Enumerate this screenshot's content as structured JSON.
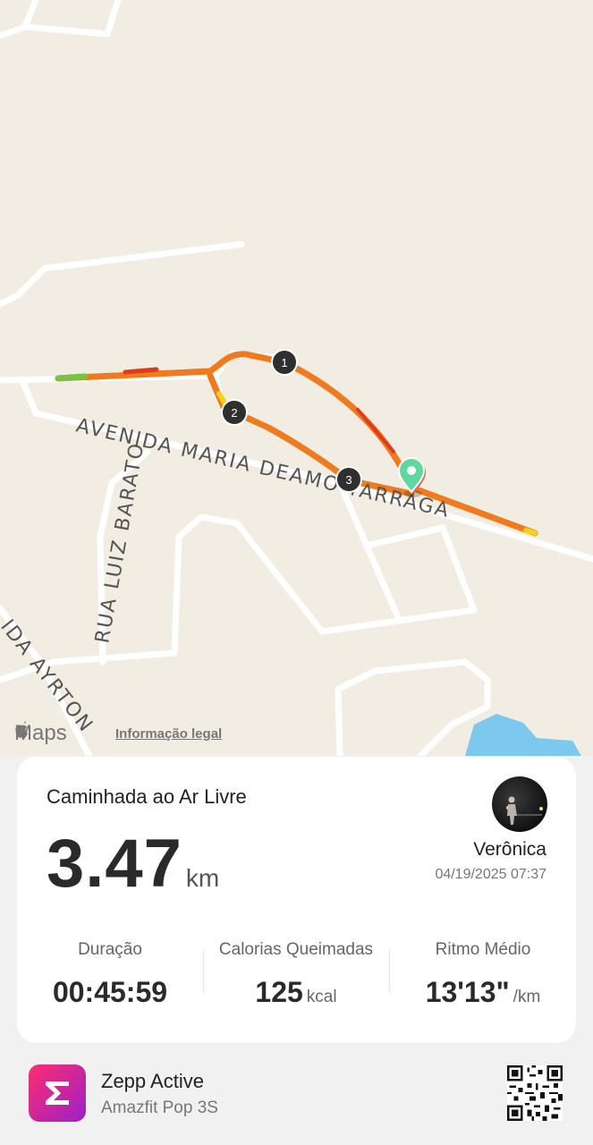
{
  "map": {
    "streets": [
      "AVENIDA MARIA DEAMO TARRAGA",
      "RUA LUIZ BARATO",
      "IDA AYRTON"
    ],
    "markers": [
      "1",
      "2",
      "3"
    ],
    "attribution": "Maps",
    "legal_link": "Informação legal"
  },
  "workout": {
    "title": "Caminhada ao Ar Livre",
    "distance": "3.47",
    "distance_unit": "km",
    "user": "Verônica",
    "datetime": "04/19/2025 07:37"
  },
  "stats": [
    {
      "label": "Duração",
      "value": "00:45:59",
      "unit": ""
    },
    {
      "label": "Calorias Queimadas",
      "value": "125",
      "unit": "kcal"
    },
    {
      "label": "Ritmo Médio",
      "value": "13'13\"",
      "unit": "/km"
    }
  ],
  "footer": {
    "app": "Zepp Active",
    "device": "Amazfit Pop 3S"
  },
  "colors": {
    "route_orange": "#f07a1e",
    "route_red": "#e03a1a",
    "route_yellow": "#f5d11c",
    "start_green": "#5fd8a0",
    "water": "#7cc8ef",
    "logo_gradient_start": "#ff2d6f",
    "logo_gradient_end": "#9b20c8"
  }
}
